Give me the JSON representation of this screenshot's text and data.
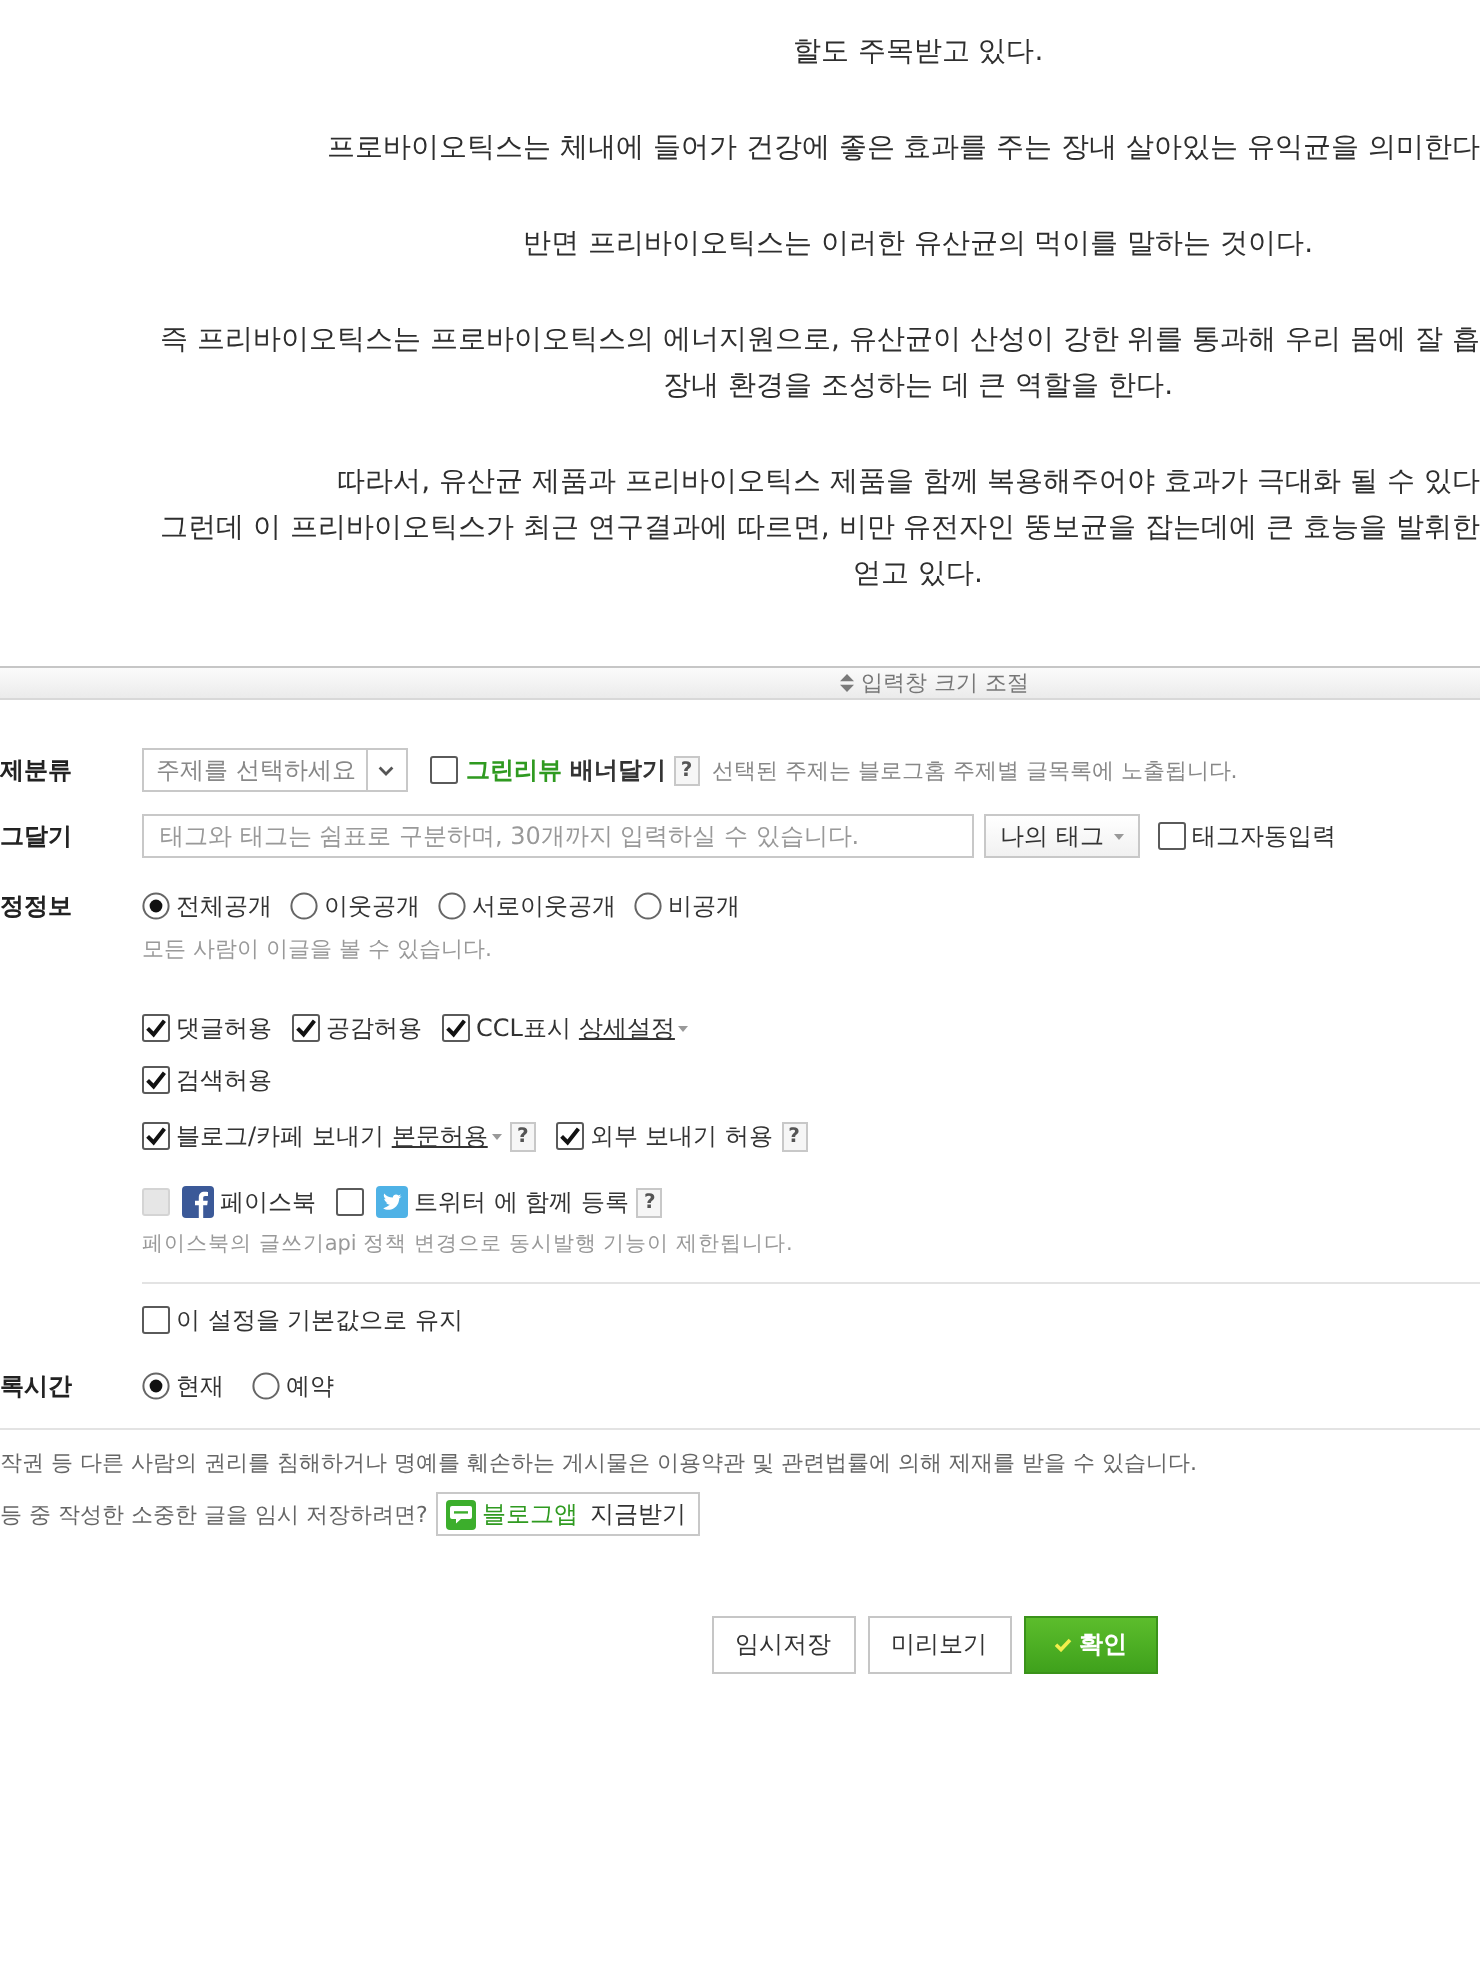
{
  "editor": {
    "paragraphs": [
      [
        "할도 주목받고 있다."
      ],
      [
        "프로바이오틱스는 체내에 들어가 건강에 좋은 효과를 주는 장내 살아있는 유익균을 의미한다"
      ],
      [
        "반면 프리바이오틱스는 이러한 유산균의 먹이를 말하는 것이다."
      ],
      [
        "즉 프리바이오틱스는 프로바이오틱스의 에너지원으로, 유산균이 산성이 강한 위를 통과해 우리 몸에 잘 흡",
        "장내 환경을 조성하는 데 큰 역할을 한다."
      ],
      [
        "따라서, 유산균 제품과 프리바이오틱스 제품을 함께 복용해주어야 효과가 극대화 될 수 있다",
        "그런데 이 프리바이오틱스가 최근 연구결과에 따르면, 비만 유전자인 뚱보균을 잡는데에 큰 효능을 발휘한",
        "얻고 있다."
      ]
    ]
  },
  "resize_bar": {
    "label": "입력창 크기 조절"
  },
  "settings": {
    "category": {
      "label": "제분류",
      "select": {
        "value": "주제를 선택하세요"
      },
      "banner": {
        "checked": false,
        "brand": "그린리뷰",
        "label": "배너달기",
        "help": "?"
      },
      "note": "선택된 주제는 블로그홈 주제별 글목록에 노출됩니다."
    },
    "tags": {
      "label": "그달기",
      "input": {
        "placeholder": "태그와 태그는 쉼표로 구분하며, 30개까지 입력하실 수 있습니다."
      },
      "my_tags_button": "나의 태그",
      "auto_input": {
        "label": "태그자동입력",
        "checked": false
      }
    },
    "privacy": {
      "label": "정정보",
      "options": [
        {
          "label": "전체공개",
          "selected": true
        },
        {
          "label": "이웃공개",
          "selected": false
        },
        {
          "label": "서로이웃공개",
          "selected": false
        },
        {
          "label": "비공개",
          "selected": false
        }
      ],
      "note": "모든 사람이 이글을 볼 수 있습니다."
    },
    "permissions": [
      {
        "items": [
          {
            "label": "댓글허용",
            "checked": true
          },
          {
            "label": "공감허용",
            "checked": true
          },
          {
            "label": "CCL표시",
            "checked": true,
            "link": "상세설정"
          }
        ]
      },
      {
        "items": [
          {
            "label": "검색허용",
            "checked": true
          }
        ]
      },
      {
        "items": [
          {
            "label": "블로그/카페 보내기",
            "checked": true,
            "link": "본문허용",
            "help": "?"
          },
          {
            "label": "외부 보내기 허용",
            "checked": true,
            "help": "?"
          }
        ]
      }
    ],
    "share": {
      "facebook": {
        "label": "페이스북",
        "checked": false,
        "disabled": true
      },
      "twitter": {
        "label": "트위터 에 함께 등록",
        "checked": false,
        "disabled": false
      },
      "help": "?",
      "note": "페이스북의 글쓰기api 정책 변경으로 동시발행 기능이 제한됩니다."
    },
    "keep_default": {
      "label": "이 설정을 기본값으로 유지",
      "checked": false
    },
    "publish_time": {
      "label": "록시간",
      "options": [
        {
          "label": "현재",
          "selected": true
        },
        {
          "label": "예약",
          "selected": false
        }
      ]
    }
  },
  "notice": "작권 등 다른 사람의 권리를 침해하거나 명예를 훼손하는 게시물은 이용약관 및 관련법률에 의해 제재를 받을 수 있습니다.",
  "app_promo": {
    "text": "등 중 작성한 소중한 글을 임시 저장하려면?",
    "button": {
      "brand": "블로그앱",
      "label": "지금받기"
    }
  },
  "actions": [
    {
      "label": "임시저장",
      "kind": "plain"
    },
    {
      "label": "미리보기",
      "kind": "plain"
    },
    {
      "label": "확인",
      "kind": "primary"
    }
  ]
}
